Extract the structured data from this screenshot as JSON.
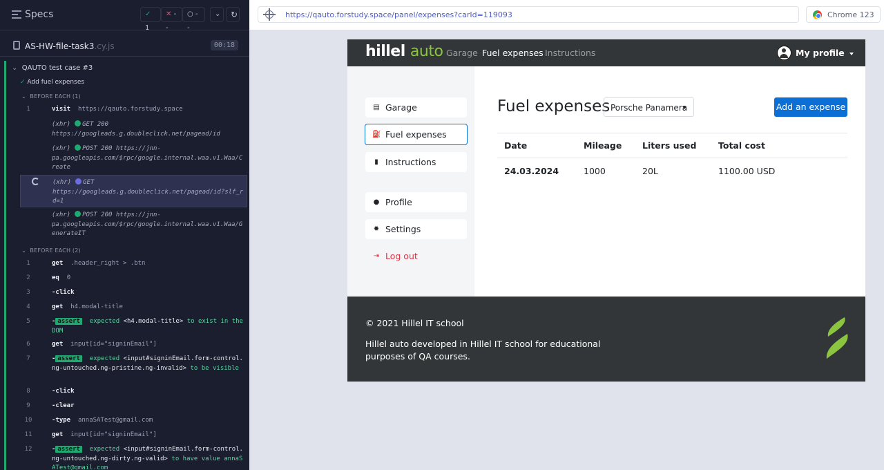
{
  "runner": {
    "specs_label": "Specs",
    "stats": {
      "passed": "1",
      "failed": "--",
      "pending": "--"
    },
    "file": {
      "name": "AS-HW-file-task3",
      "ext": ".cy.js",
      "time": "00:18"
    },
    "suite_title": "QAUTO test case #3",
    "test_title": "Add fuel expenses",
    "before_each_1": "BEFORE EACH (1)",
    "before_each_2": "BEFORE EACH (2)",
    "cmd1": {
      "num": "1",
      "name": "visit",
      "arg": "https://qauto.forstudy.space"
    },
    "xhr1": {
      "tag": "(xhr)",
      "method": "GET 200",
      "url": "https://googleads.g.doubleclick.net/pagead/id"
    },
    "xhr2": {
      "tag": "(xhr)",
      "method": "POST 200 https://jnn-",
      "url": "pa.googleapis.com/$rpc/google.internal.waa.v1.Waa/Create"
    },
    "xhr3": {
      "tag": "(xhr)",
      "method": "GET",
      "url": "https://googleads.g.doubleclick.net/pagead/id?slf_rd=1"
    },
    "xhr4": {
      "tag": "(xhr)",
      "method": "POST 200 https://jnn-",
      "url": "pa.googleapis.com/$rpc/google.internal.waa.v1.Waa/GenerateIT"
    },
    "c1": {
      "num": "1",
      "name": "get",
      "arg": ".header_right > .btn"
    },
    "c2": {
      "num": "2",
      "name": "eq",
      "arg": "0"
    },
    "c3": {
      "num": "3",
      "name": "-click"
    },
    "c4": {
      "num": "4",
      "name": "get",
      "arg": "h4.modal-title"
    },
    "c5": {
      "num": "5",
      "dash": "-",
      "tag": "assert",
      "text1": "expected",
      "text2": "<h4.modal-title>",
      "text3": "to exist in the DOM"
    },
    "c6": {
      "num": "6",
      "name": "get",
      "arg": "input[id=\"signinEmail\"]"
    },
    "c7": {
      "num": "7",
      "dash": "-",
      "tag": "assert",
      "text1": "expected",
      "text2": "<input#signinEmail.form-control.ng-untouched.ng-pristine.ng-invalid>",
      "text3": "to be visible"
    },
    "c8": {
      "num": "8",
      "name": "-click"
    },
    "c9": {
      "num": "9",
      "name": "-clear"
    },
    "c10": {
      "num": "10",
      "name": "-type",
      "arg": "annaSATest@gmail.com"
    },
    "c11": {
      "num": "11",
      "name": "get",
      "arg": "input[id=\"signinEmail\"]"
    },
    "c12": {
      "num": "12",
      "dash": "-",
      "tag": "assert",
      "text1": "expected",
      "text2": "<input#signinEmail.form-control.ng-untouched.ng-dirty.ng-valid>",
      "text3": "to have value annaSATest@gmail.com"
    }
  },
  "browser": {
    "url": "https://qauto.forstudy.space/panel/expenses?carId=119093",
    "browser_label": "Chrome 123"
  },
  "app": {
    "logo_a": "hillel",
    "logo_b": "auto",
    "nav": [
      "Garage",
      "Fuel expenses",
      "Instructions"
    ],
    "profile_label": "My profile",
    "sidebar": [
      {
        "label": "Garage",
        "icon": "garage-icon"
      },
      {
        "label": "Fuel expenses",
        "icon": "fuel-icon"
      },
      {
        "label": "Instructions",
        "icon": "file-icon"
      },
      {
        "label": "Profile",
        "icon": "user-icon"
      },
      {
        "label": "Settings",
        "icon": "gear-icon"
      },
      {
        "label": "Log out",
        "icon": "logout-icon"
      }
    ],
    "title": "Fuel expenses",
    "car": "Porsche Panamera",
    "add_button": "Add an expense",
    "table": {
      "headers": [
        "Date",
        "Mileage",
        "Liters used",
        "Total cost"
      ],
      "rows": [
        [
          "24.03.2024",
          "1000",
          "20L",
          "1100.00 USD"
        ]
      ]
    },
    "footer": {
      "copyright": "© 2021 Hillel IT school",
      "about": "Hillel auto developed in Hillel IT school for educational purposes of QA courses."
    },
    "colors": {
      "accent": "#0b6fd6",
      "brand_green": "#8bc540",
      "danger": "#dc3545",
      "pass": "#1fa971"
    }
  }
}
